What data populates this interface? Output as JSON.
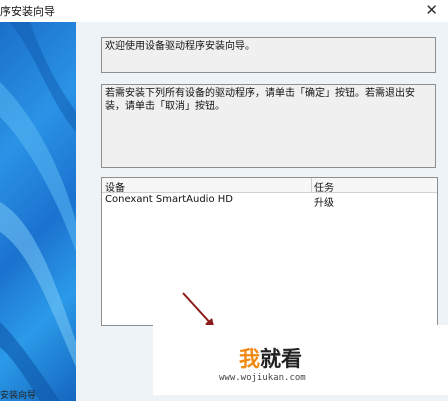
{
  "window": {
    "title": "序安装向导",
    "close_glyph": "✕"
  },
  "welcome_text": "欢迎使用设备驱动程序安装向导。",
  "instructions_text": "若需安装下列所有设备的驱动程序，请单击「确定」按钮。若需退出安装，请单击「取消」按钮。",
  "device_list": {
    "columns": [
      "设备",
      "任务"
    ],
    "rows": [
      {
        "device": "Conexant SmartAudio HD",
        "task": "升级"
      }
    ]
  },
  "bottom_label": "安装向导",
  "watermark": {
    "logo_part1": "我",
    "logo_part2": "就看",
    "url": "www.wojiukan.com"
  },
  "colors": {
    "annotation_arrow": "#8b1a1a",
    "watermark_accent": "#f08a12"
  }
}
